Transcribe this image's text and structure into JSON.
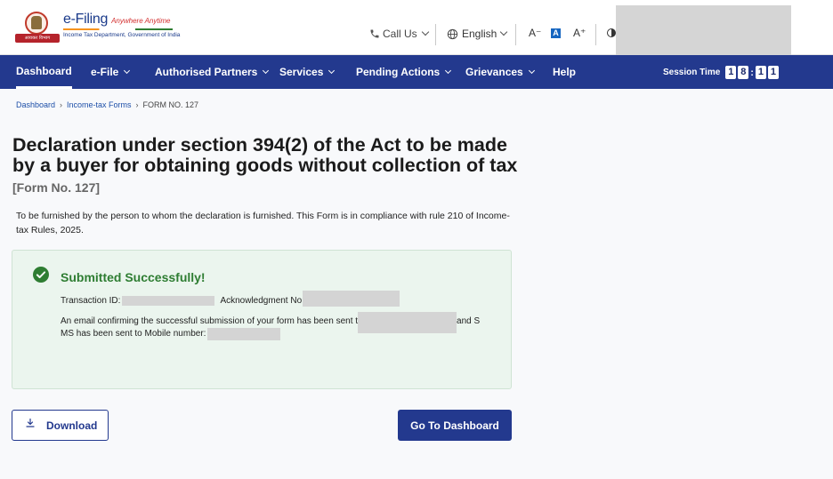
{
  "header": {
    "logo_title": "e-Filing",
    "logo_tagline": "Anywhere Anytime",
    "logo_subtitle": "Income Tax Department, Government of India",
    "emblem_ribbon": "आयकर विभाग",
    "call_us": "Call Us",
    "language": "English",
    "font_decrease": "A⁻",
    "font_normal": "A",
    "font_increase": "A⁺"
  },
  "nav": {
    "items": [
      {
        "label": "Dashboard"
      },
      {
        "label": "e-File"
      },
      {
        "label": "Authorised Partners"
      },
      {
        "label": "Services"
      },
      {
        "label": "Pending Actions"
      },
      {
        "label": "Grievances"
      },
      {
        "label": "Help"
      }
    ],
    "session_label": "Session Time",
    "session_digits": [
      "1",
      "8",
      "1",
      "1"
    ]
  },
  "breadcrumb": {
    "items": [
      "Dashboard",
      "Income-tax Forms"
    ],
    "current": "FORM NO. 127"
  },
  "page": {
    "title": "Declaration under section 394(2) of the Act to be made by a buyer for obtaining goods without collection of tax",
    "form_no": "[Form No. 127]",
    "description": "To be furnished by the person to whom the declaration is furnished. This Form is in compliance with rule 210 of Income-tax Rules, 2025."
  },
  "success": {
    "title": "Submitted Successfully!",
    "txn_label": "Transaction ID:",
    "ack_label": "Acknowledgment No",
    "msg_part1": "An email confirming the successful submission of your form has been sent t",
    "msg_part2": "and S",
    "msg_part3": "MS has been sent to Mobile number: "
  },
  "buttons": {
    "download": "Download",
    "dashboard": "Go To Dashboard"
  },
  "colors": {
    "nav_bg": "#23398e",
    "success_green": "#2e7d32",
    "card_bg": "#ebf5ee"
  }
}
